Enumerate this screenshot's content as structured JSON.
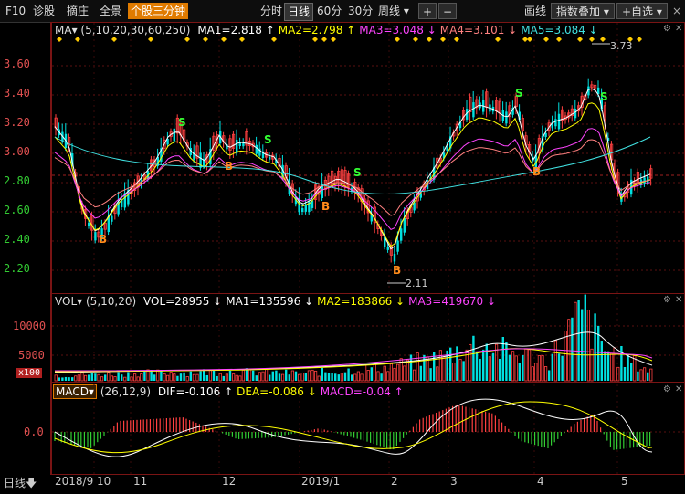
{
  "toolbar": {
    "left_items": [
      "F10",
      "诊股",
      "摘庄",
      "全景"
    ],
    "active_tab": "个股三分钟",
    "periods": [
      "分时",
      "日线",
      "60分",
      "30分",
      "周线"
    ],
    "selected_period": "日线",
    "plus_label": "+",
    "minus_label": "−",
    "right_items": [
      "画线",
      "指数叠加",
      "+自选"
    ],
    "close_glyph": "×"
  },
  "ma_legend": {
    "name": "MA",
    "params": "(5,10,20,30,60,250)",
    "items": [
      {
        "label": "MA1=2.818",
        "arrow": "↑",
        "color": "#ffffff"
      },
      {
        "label": "MA2=2.798",
        "arrow": "↑",
        "color": "#ffff00"
      },
      {
        "label": "MA3=3.048",
        "arrow": "↓",
        "color": "#ff44ff"
      },
      {
        "label": "MA4=3.101",
        "arrow": "↓",
        "color": "#ff8080"
      },
      {
        "label": "MA5=3.084",
        "arrow": "↓",
        "color": "#40e0e0"
      }
    ]
  },
  "price_axis": [
    "3.60",
    "3.40",
    "3.20",
    "3.00",
    "2.80",
    "2.60",
    "2.40",
    "2.20"
  ],
  "high_label": "3.73",
  "low_label": "2.11",
  "markers": {
    "buy": "B",
    "sell": "S"
  },
  "vol_legend": {
    "name": "VOL",
    "params": "(5,10,20)",
    "items": [
      {
        "label": "VOL=28955",
        "arrow": "↓",
        "color": "#ffffff"
      },
      {
        "label": "MA1=135596",
        "arrow": "↓",
        "color": "#ffffff"
      },
      {
        "label": "MA2=183866",
        "arrow": "↓",
        "color": "#ffff00"
      },
      {
        "label": "MA3=419670",
        "arrow": "↓",
        "color": "#ff44ff"
      }
    ]
  },
  "vol_axis": [
    "10000",
    "5000"
  ],
  "vol_unit": "x100",
  "macd_legend": {
    "name": "MACD",
    "params": "(26,12,9)",
    "items": [
      {
        "label": "DIF=-0.106",
        "arrow": "↑",
        "color": "#ffffff"
      },
      {
        "label": "DEA=-0.086",
        "arrow": "↓",
        "color": "#ffff00"
      },
      {
        "label": "MACD=-0.04",
        "arrow": "↑",
        "color": "#ff44ff"
      }
    ]
  },
  "macd_axis": [
    "0.0"
  ],
  "x_axis": {
    "period_label": "日线",
    "labels": [
      "2018/9",
      "10",
      "11",
      "12",
      "2019/1",
      "2",
      "3",
      "4",
      "5"
    ]
  },
  "colors": {
    "up": "#ff4040",
    "down": "#00e0e0",
    "accent": "#e07b00",
    "grid": "#7a1414"
  }
}
